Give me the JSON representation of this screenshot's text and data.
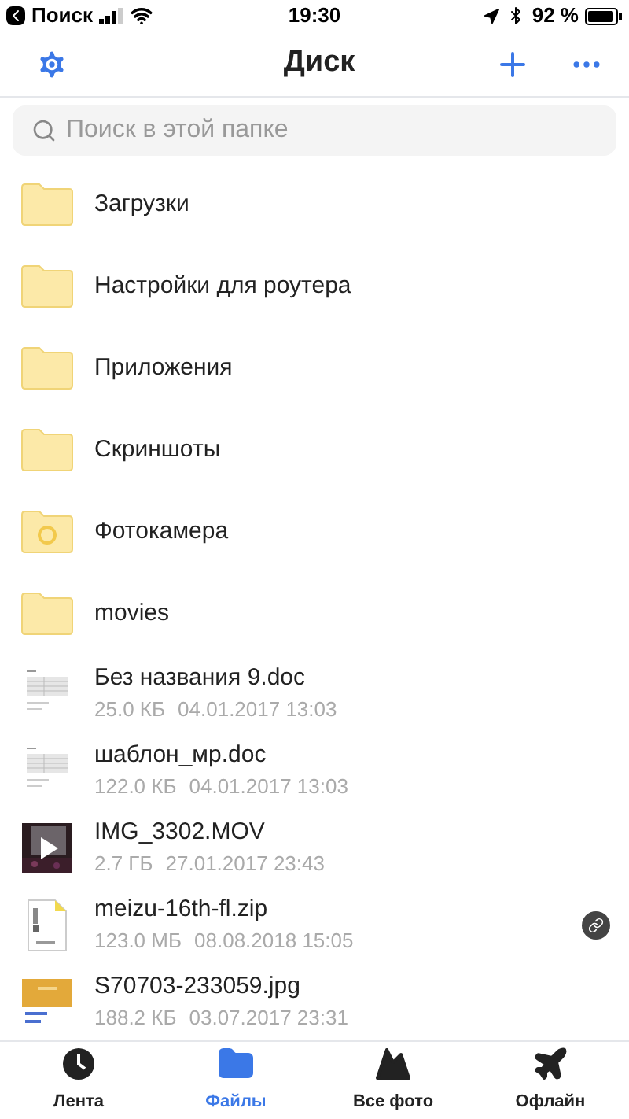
{
  "status_bar": {
    "back_label": "Поиск",
    "time": "19:30",
    "battery_percent": "92 %"
  },
  "header": {
    "title": "Диск"
  },
  "search": {
    "placeholder": "Поиск в этой папке"
  },
  "items": [
    {
      "kind": "folder",
      "name": "Загрузки"
    },
    {
      "kind": "folder",
      "name": "Настройки для роутера"
    },
    {
      "kind": "folder",
      "name": "Приложения"
    },
    {
      "kind": "folder",
      "name": "Скриншоты"
    },
    {
      "kind": "camera",
      "name": "Фотокамера"
    },
    {
      "kind": "folder",
      "name": "movies"
    },
    {
      "kind": "doc",
      "name": "Без названия 9.doc",
      "size": "25.0 КБ",
      "date": "04.01.2017 13:03",
      "shared": false
    },
    {
      "kind": "doc",
      "name": "шаблон_мр.doc",
      "size": "122.0 КБ",
      "date": "04.01.2017 13:03",
      "shared": false
    },
    {
      "kind": "video",
      "name": "IMG_3302.MOV",
      "size": "2.7 ГБ",
      "date": "27.01.2017 23:43",
      "shared": false
    },
    {
      "kind": "zip",
      "name": "meizu-16th-fl.zip",
      "size": "123.0 МБ",
      "date": "08.08.2018 15:05",
      "shared": true
    },
    {
      "name": "S70703-233059.jpg",
      "size": "188.2 КБ",
      "date": "03.07.2017 23:31",
      "shared": false
    }
  ],
  "tabs": [
    {
      "kind": "feed",
      "label": "Лента",
      "selected": false
    },
    {
      "kind": "files",
      "label": "Файлы",
      "selected": true
    },
    {
      "kind": "photos",
      "label": "Все фото",
      "selected": false
    },
    {
      "kind": "offline",
      "label": "Офлайн",
      "selected": false
    }
  ]
}
